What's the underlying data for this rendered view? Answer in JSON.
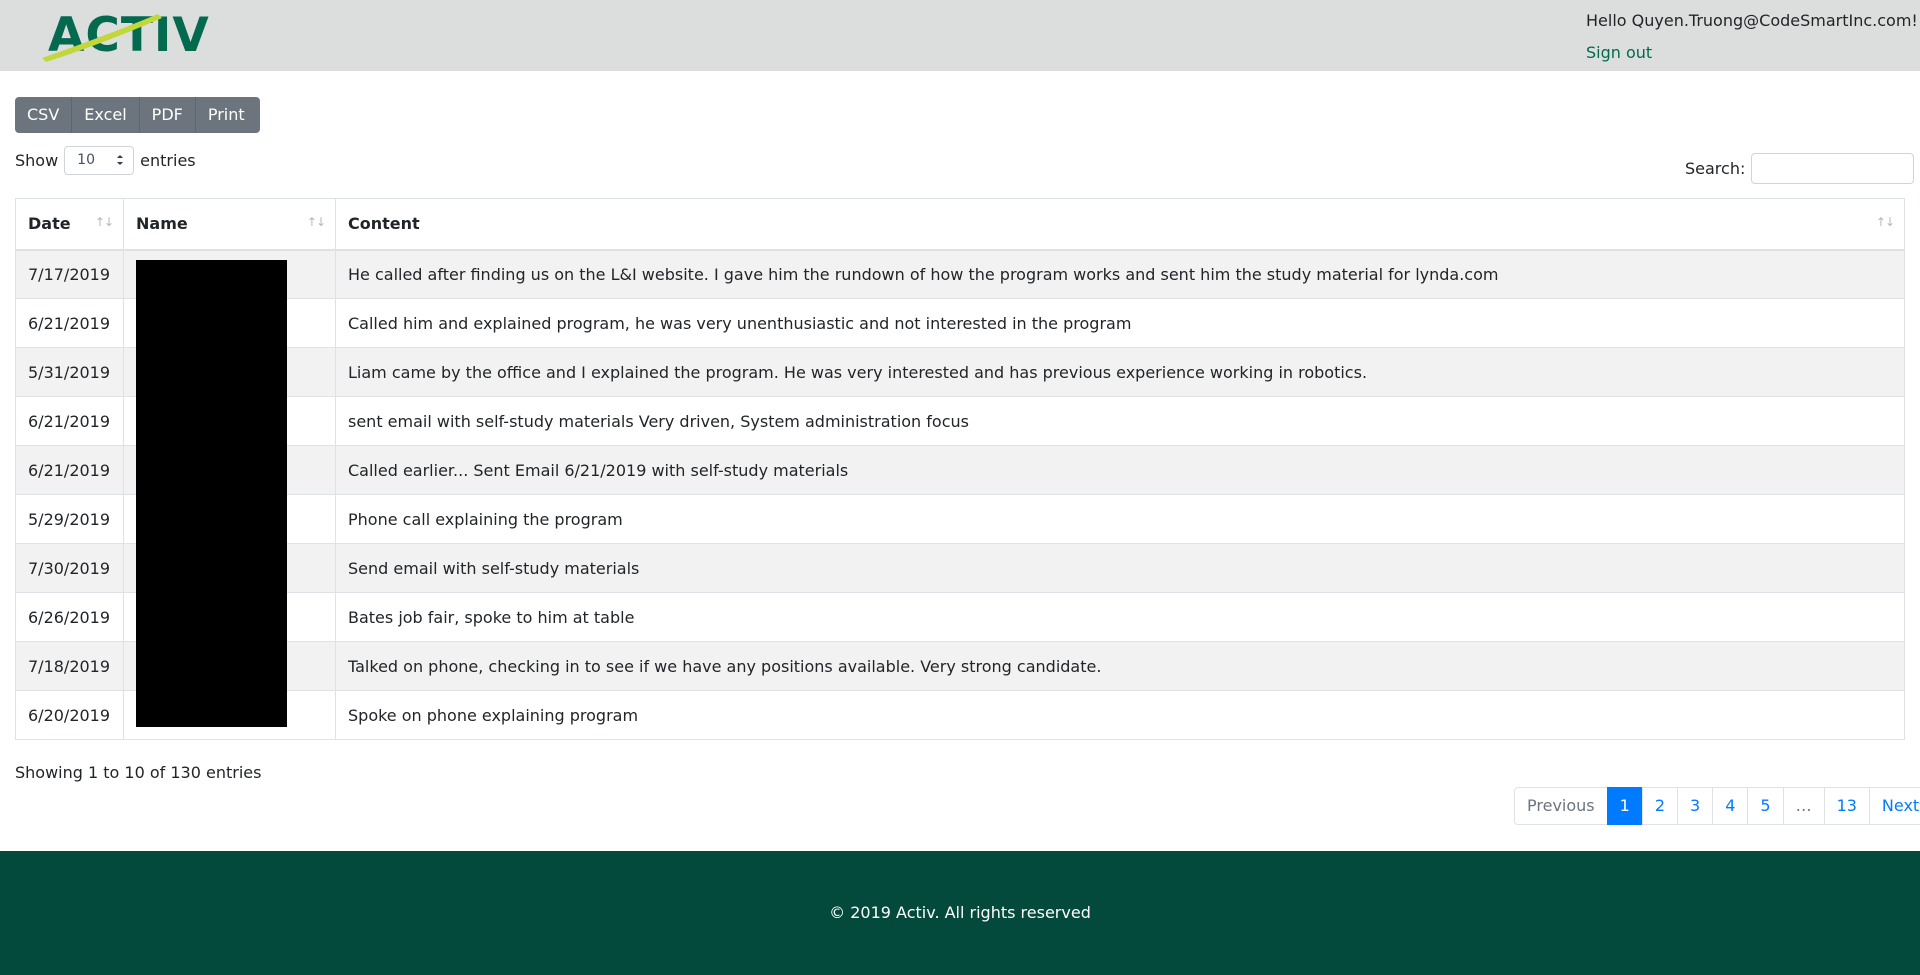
{
  "header": {
    "logo_text": "ACTIV",
    "greeting": "Hello Quyen.Truong@CodeSmartInc.com!",
    "sign_out": "Sign out"
  },
  "export_buttons": [
    "CSV",
    "Excel",
    "PDF",
    "Print"
  ],
  "length_control": {
    "prefix": "Show",
    "value": "10",
    "suffix": "entries"
  },
  "search": {
    "label": "Search:",
    "value": ""
  },
  "table": {
    "columns": [
      "Date",
      "Name",
      "Content"
    ],
    "rows": [
      {
        "date": "7/17/2019",
        "name": "",
        "content": "He called after finding us on the L&I website. I gave him the rundown of how the program works and sent him the study material for lynda.com"
      },
      {
        "date": "6/21/2019",
        "name": "",
        "content": "Called him and explained program, he was very unenthusiastic and not interested in the program"
      },
      {
        "date": "5/31/2019",
        "name": "",
        "content": "Liam came by the office and I explained the program. He was very interested and has previous experience working in robotics."
      },
      {
        "date": "6/21/2019",
        "name": "",
        "content": "sent email with self-study materials Very driven, System administration focus"
      },
      {
        "date": "6/21/2019",
        "name": "",
        "content": "Called earlier... Sent Email 6/21/2019 with self-study materials"
      },
      {
        "date": "5/29/2019",
        "name": "",
        "content": "Phone call explaining the program"
      },
      {
        "date": "7/30/2019",
        "name": "",
        "content": "Send email with self-study materials"
      },
      {
        "date": "6/26/2019",
        "name": "",
        "content": "Bates job fair, spoke to him at table"
      },
      {
        "date": "7/18/2019",
        "name": "",
        "content": "Talked on phone, checking in to see if we have any positions available. Very strong candidate."
      },
      {
        "date": "6/20/2019",
        "name": "",
        "content": "Spoke on phone explaining program"
      }
    ]
  },
  "info": "Showing 1 to 10 of 130 entries",
  "pagination": [
    "Previous",
    "1",
    "2",
    "3",
    "4",
    "5",
    "…",
    "13",
    "Next"
  ],
  "pagination_active": "1",
  "footer": {
    "copyright": "© 2019 Activ. All rights reserved"
  },
  "colors": {
    "brand_green": "#03694f",
    "footer_bg": "#034a3d",
    "header_bg": "#dcdedd",
    "accent_blue": "#007bff"
  }
}
